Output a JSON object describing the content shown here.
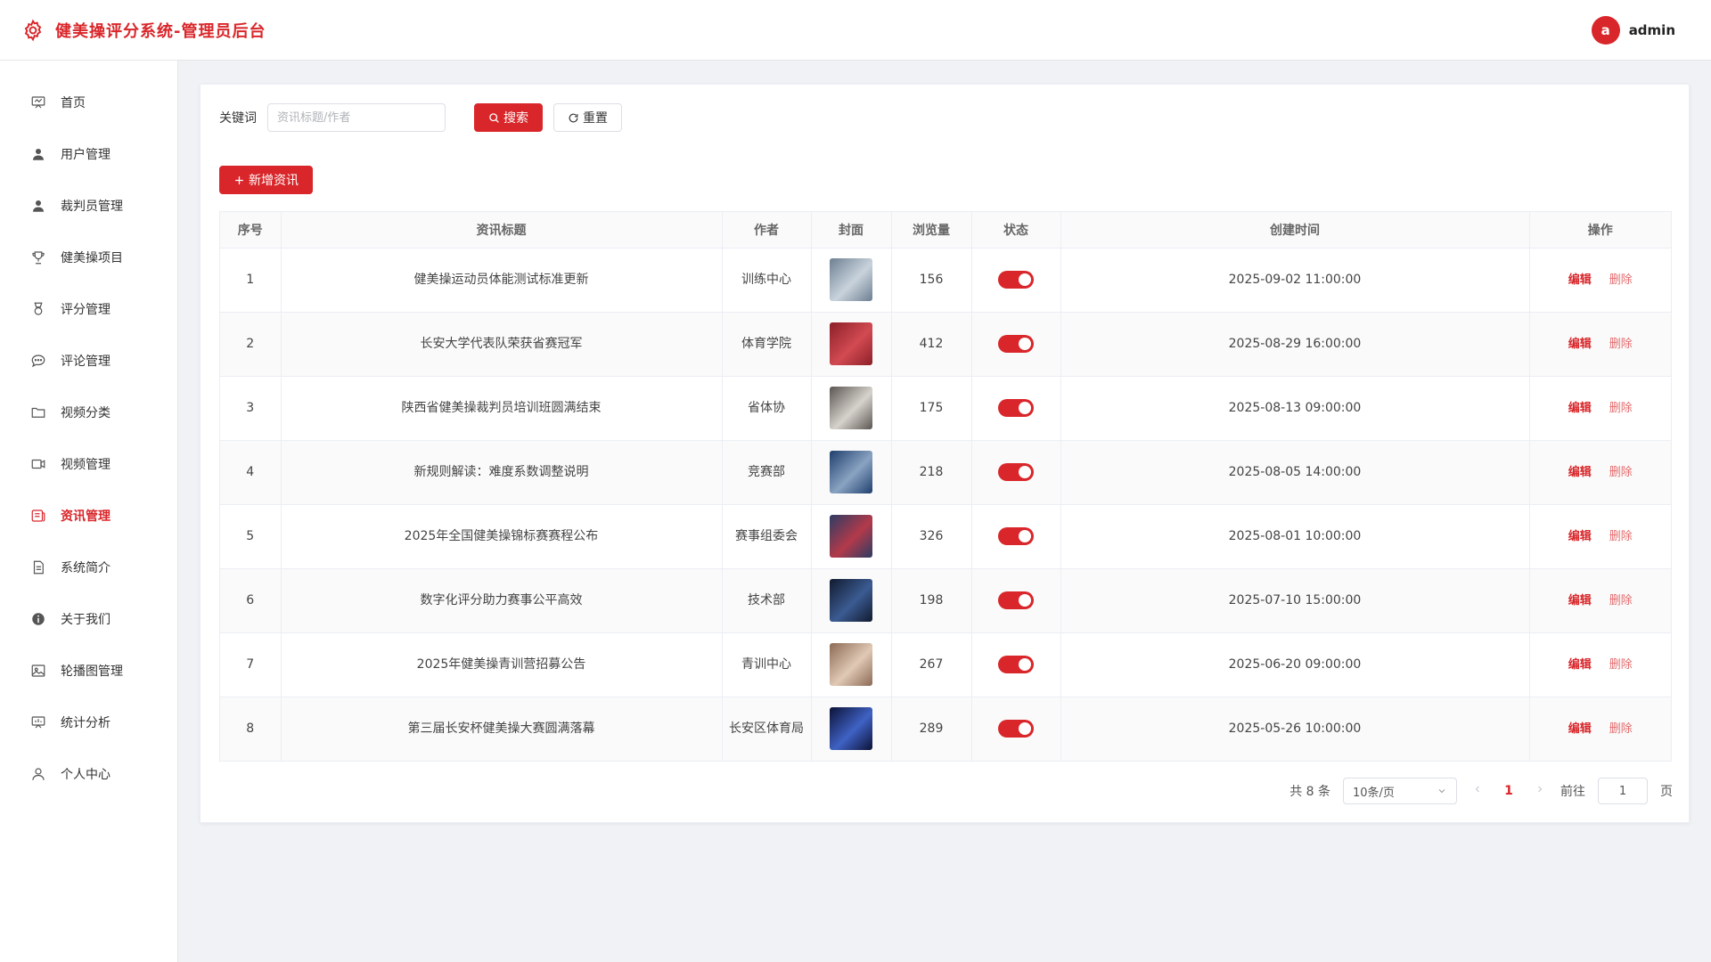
{
  "header": {
    "title": "健美操评分系统-管理员后台",
    "avatar_letter": "a",
    "username": "admin",
    "brand_color": "#d9262a"
  },
  "sidebar": {
    "items": [
      {
        "label": "首页",
        "icon": "presentation-icon",
        "active": false
      },
      {
        "label": "用户管理",
        "icon": "user-icon",
        "active": false
      },
      {
        "label": "裁判员管理",
        "icon": "user-icon",
        "active": false
      },
      {
        "label": "健美操项目",
        "icon": "trophy-icon",
        "active": false
      },
      {
        "label": "评分管理",
        "icon": "medal-icon",
        "active": false
      },
      {
        "label": "评论管理",
        "icon": "chat-bubble-icon",
        "active": false
      },
      {
        "label": "视频分类",
        "icon": "folder-icon",
        "active": false
      },
      {
        "label": "视频管理",
        "icon": "video-camera-icon",
        "active": false
      },
      {
        "label": "资讯管理",
        "icon": "news-icon",
        "active": true
      },
      {
        "label": "系统简介",
        "icon": "document-icon",
        "active": false
      },
      {
        "label": "关于我们",
        "icon": "info-icon",
        "active": false
      },
      {
        "label": "轮播图管理",
        "icon": "image-icon",
        "active": false
      },
      {
        "label": "统计分析",
        "icon": "chart-board-icon",
        "active": false
      },
      {
        "label": "个人中心",
        "icon": "person-outline-icon",
        "active": false
      }
    ]
  },
  "toolbar": {
    "keyword_label": "关键词",
    "search_placeholder": "资讯标题/作者",
    "search_label": "搜索",
    "reset_label": "重置",
    "add_label": "新增资讯"
  },
  "table": {
    "columns": [
      "序号",
      "资讯标题",
      "作者",
      "封面",
      "浏览量",
      "状态",
      "创建时间",
      "操作"
    ],
    "edit_label": "编辑",
    "delete_label": "删除",
    "rows": [
      {
        "index": "1",
        "title": "健美操运动员体能测试标准更新",
        "author": "训练中心",
        "views": "156",
        "enabled": true,
        "created": "2025-09-02 11:00:00",
        "cover_colors": [
          "#6d7f92",
          "#c9d3dc"
        ]
      },
      {
        "index": "2",
        "title": "长安大学代表队荣获省赛冠军",
        "author": "体育学院",
        "views": "412",
        "enabled": true,
        "created": "2025-08-29 16:00:00",
        "cover_colors": [
          "#8c1f28",
          "#d24a52"
        ]
      },
      {
        "index": "3",
        "title": "陕西省健美操裁判员培训班圆满结束",
        "author": "省体协",
        "views": "175",
        "enabled": true,
        "created": "2025-08-13 09:00:00",
        "cover_colors": [
          "#5a5550",
          "#d6d2cc"
        ]
      },
      {
        "index": "4",
        "title": "新规则解读：难度系数调整说明",
        "author": "竞赛部",
        "views": "218",
        "enabled": true,
        "created": "2025-08-05 14:00:00",
        "cover_colors": [
          "#1f3f6e",
          "#8aa3c2"
        ]
      },
      {
        "index": "5",
        "title": "2025年全国健美操锦标赛赛程公布",
        "author": "赛事组委会",
        "views": "326",
        "enabled": true,
        "created": "2025-08-01 10:00:00",
        "cover_colors": [
          "#2c3c63",
          "#b33a4a"
        ]
      },
      {
        "index": "6",
        "title": "数字化评分助力赛事公平高效",
        "author": "技术部",
        "views": "198",
        "enabled": true,
        "created": "2025-07-10 15:00:00",
        "cover_colors": [
          "#111a2e",
          "#3b5b92"
        ]
      },
      {
        "index": "7",
        "title": "2025年健美操青训营招募公告",
        "author": "青训中心",
        "views": "267",
        "enabled": true,
        "created": "2025-06-20 09:00:00",
        "cover_colors": [
          "#8c6a55",
          "#e0c9b5"
        ]
      },
      {
        "index": "8",
        "title": "第三届长安杯健美操大赛圆满落幕",
        "author": "长安区体育局",
        "views": "289",
        "enabled": true,
        "created": "2025-05-26 10:00:00",
        "cover_colors": [
          "#0c1236",
          "#3f62c4"
        ]
      }
    ]
  },
  "pagination": {
    "total_label": "共 8 条",
    "page_size": "10条/页",
    "current_page": "1",
    "goto_label": "前往",
    "goto_value": "1",
    "page_suffix": "页"
  }
}
